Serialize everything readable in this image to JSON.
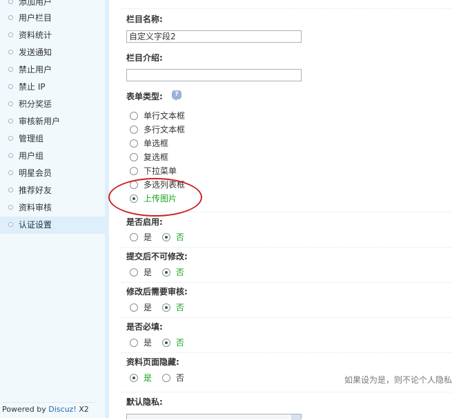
{
  "sidebar": {
    "items": [
      {
        "label": "添加用户"
      },
      {
        "label": "用户栏目"
      },
      {
        "label": "资料统计"
      },
      {
        "label": "发送通知"
      },
      {
        "label": "禁止用户"
      },
      {
        "label": "禁止 IP"
      },
      {
        "label": "积分奖惩"
      },
      {
        "label": "审核新用户"
      },
      {
        "label": "管理组"
      },
      {
        "label": "用户组"
      },
      {
        "label": "明星会员"
      },
      {
        "label": "推荐好友"
      },
      {
        "label": "资料审核"
      },
      {
        "label": "认证设置"
      }
    ],
    "active_index": 13,
    "powered_prefix": "Powered by ",
    "powered_brand": "Discuz!",
    "powered_version": " X2"
  },
  "form": {
    "name_label": "栏目名称:",
    "name_value": "自定义字段2",
    "intro_label": "栏目介绍:",
    "intro_value": "",
    "type_label": "表单类型:",
    "type_options": [
      {
        "label": "单行文本框",
        "checked": false
      },
      {
        "label": "多行文本框",
        "checked": false
      },
      {
        "label": "单选框",
        "checked": false
      },
      {
        "label": "复选框",
        "checked": false
      },
      {
        "label": "下拉菜单",
        "checked": false
      },
      {
        "label": "多选列表框",
        "checked": false
      },
      {
        "label": "上传图片",
        "checked": true
      }
    ],
    "enabled_label": "是否启用:",
    "enabled_yes": "是",
    "enabled_no": "否",
    "readonly_label": "提交后不可修改:",
    "readonly_yes": "是",
    "readonly_no": "否",
    "review_label": "修改后需要审核:",
    "review_yes": "是",
    "review_no": "否",
    "required_label": "是否必填:",
    "required_yes": "是",
    "required_no": "否",
    "hidden_label": "资料页面隐藏:",
    "hidden_yes": "是",
    "hidden_no": "否",
    "hidden_hint": "如果设为是，则不论个人隐私",
    "privacy_label": "默认隐私:"
  },
  "colors": {
    "annotation": "#cc1f1f",
    "checked_text": "#1aa31a",
    "sidebar_bg": "#f2f9fd"
  },
  "icons": {
    "help": "question-bubble",
    "nav_bullet": "hollow-circle"
  }
}
